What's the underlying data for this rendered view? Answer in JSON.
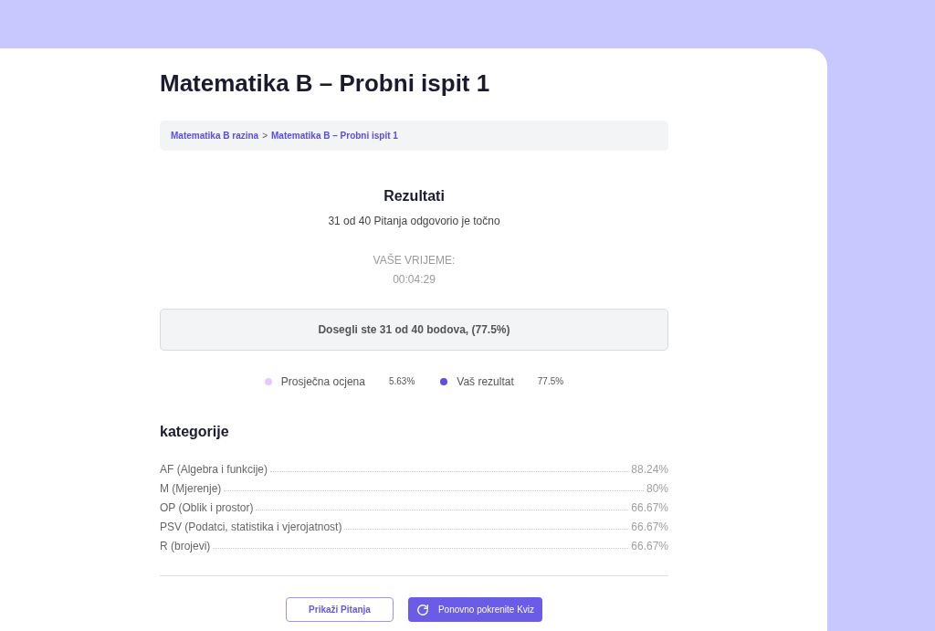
{
  "title": "Matematika B – Probni ispit 1",
  "breadcrumb": [
    {
      "label": "Matematika B razina"
    },
    {
      "separator": ">"
    },
    {
      "label": "Matematika B – Probni ispit 1"
    }
  ],
  "results": {
    "heading": "Rezultati",
    "summary": "31 od 40 Pitanja odgovorio je točno",
    "time_label": "VAŠE VRIJEME:",
    "time_value": "00:04:29",
    "score": "Dosegli ste 31 od 40 bodova, (77.5%)"
  },
  "legend": [
    {
      "label": "Prosječna ocjena",
      "value": "5.63%",
      "color": "#e6c9f9"
    },
    {
      "label": "Vaš rezultat",
      "value": "77.5%",
      "color": "#5e4fe0"
    }
  ],
  "categories": {
    "heading": "kategorije",
    "rows": [
      {
        "name": "AF (Algebra i funkcije)",
        "value": "88.24%"
      },
      {
        "name": "M (Mjerenje)",
        "value": "80%"
      },
      {
        "name": "OP (Oblik i prostor)",
        "value": "66.67%"
      },
      {
        "name": "PSV (Podatci, statistika i vjerojatnost)",
        "value": "66.67%"
      },
      {
        "name": "R (brojevi)",
        "value": "66.67%"
      }
    ]
  },
  "buttons": [
    {
      "label": "Prikaži Pitanja",
      "kind": "outline"
    },
    {
      "label": "Ponovno pokrenite Kviz",
      "kind": "restart"
    }
  ]
}
